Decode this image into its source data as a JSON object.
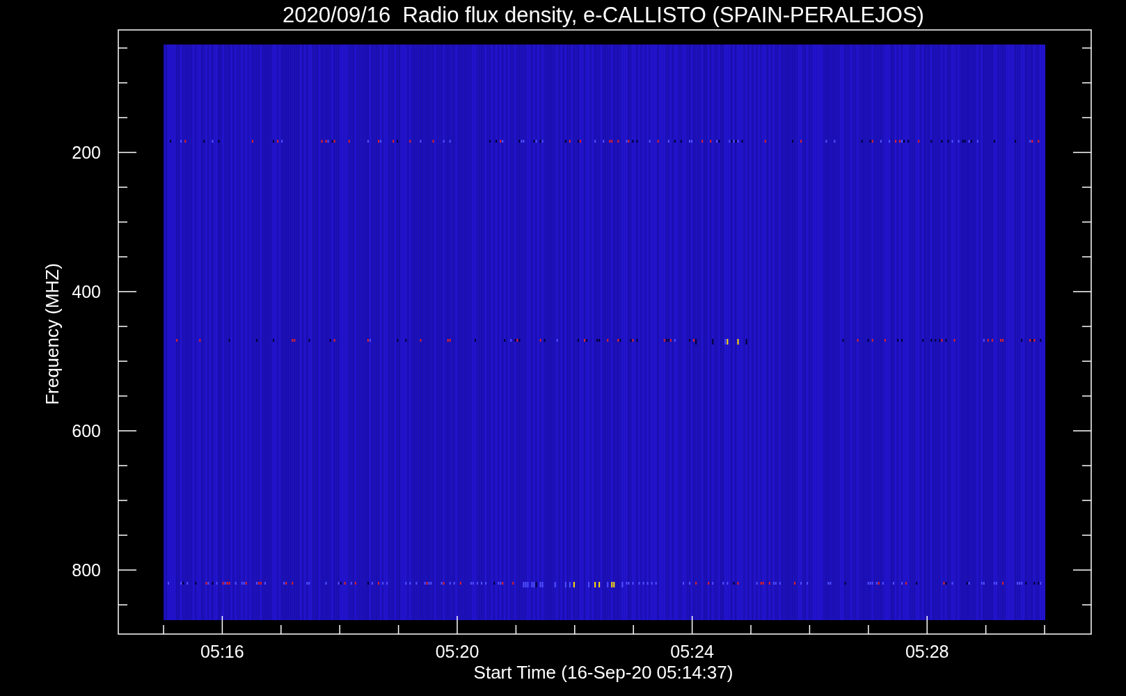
{
  "title": "2020/09/16  Radio flux density, e-CALLISTO (SPAIN-PERALEJOS)",
  "y_axis": {
    "label": "Frequency (MHZ)",
    "ticks": [
      "200",
      "400",
      "600",
      "800"
    ]
  },
  "x_axis": {
    "label": "Start Time (16-Sep-20 05:14:37)",
    "ticks": [
      "05:16",
      "05:20",
      "05:24",
      "05:28"
    ]
  }
}
